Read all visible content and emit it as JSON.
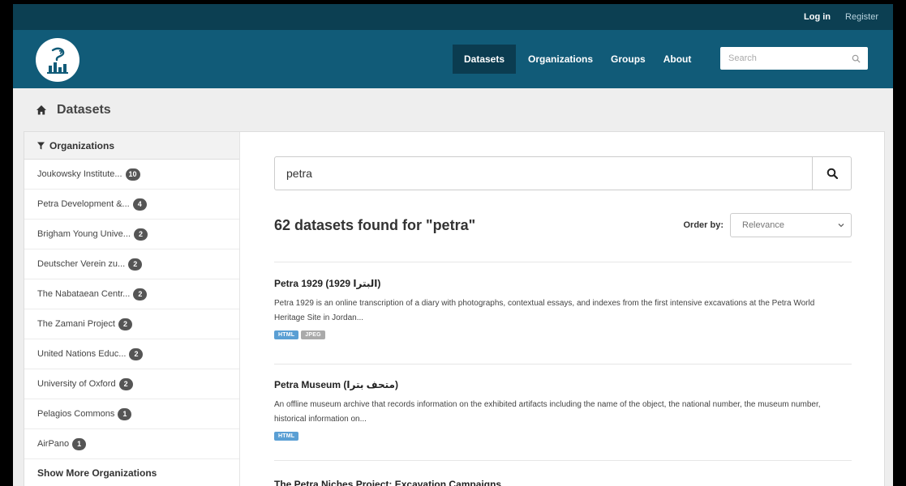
{
  "account": {
    "login": "Log in",
    "register": "Register"
  },
  "nav": {
    "items": [
      {
        "label": "Datasets",
        "active": true
      },
      {
        "label": "Organizations"
      },
      {
        "label": "Groups"
      },
      {
        "label": "About"
      }
    ],
    "search_placeholder": "Search"
  },
  "breadcrumb": {
    "current": "Datasets"
  },
  "sidebar": {
    "heading": "Organizations",
    "items": [
      {
        "label": "Joukowsky Institute...",
        "count": "10"
      },
      {
        "label": "Petra Development &...",
        "count": "4"
      },
      {
        "label": "Brigham Young Unive...",
        "count": "2"
      },
      {
        "label": "Deutscher Verein zu...",
        "count": "2"
      },
      {
        "label": "The Nabataean Centr...",
        "count": "2"
      },
      {
        "label": "The Zamani Project",
        "count": "2"
      },
      {
        "label": "United Nations Educ...",
        "count": "2"
      },
      {
        "label": "University of Oxford",
        "count": "2"
      },
      {
        "label": "Pelagios Commons",
        "count": "1"
      },
      {
        "label": "AirPano",
        "count": "1"
      }
    ],
    "show_more": "Show More Organizations"
  },
  "search": {
    "query": "petra"
  },
  "results": {
    "count_text": "62 datasets found for \"petra\"",
    "order_label": "Order by:",
    "order_value": "Relevance"
  },
  "datasets": [
    {
      "title": "Petra 1929 (البترا 1929)",
      "description": "Petra 1929 is an online transcription of a diary with photographs, contextual essays, and indexes from the first intensive excavations at the Petra World Heritage Site in Jordan...",
      "formats": [
        "HTML",
        "JPEG"
      ]
    },
    {
      "title": "Petra Museum (متحف بترا)",
      "description": "An offline museum archive that records information on the exhibited artifacts including the name of the object, the national number, the museum number, historical information on...",
      "formats": [
        "HTML"
      ]
    },
    {
      "title": "The Petra Niches Project: Excavation Campaigns",
      "description": "",
      "formats": []
    }
  ],
  "colors": {
    "account_bar": "#0c3f52",
    "masthead": "#115b78",
    "nav_active": "#0b3c50",
    "badge": "#555555",
    "format_html": "#5a9fd4",
    "format_jpeg": "#aaaaaa"
  }
}
